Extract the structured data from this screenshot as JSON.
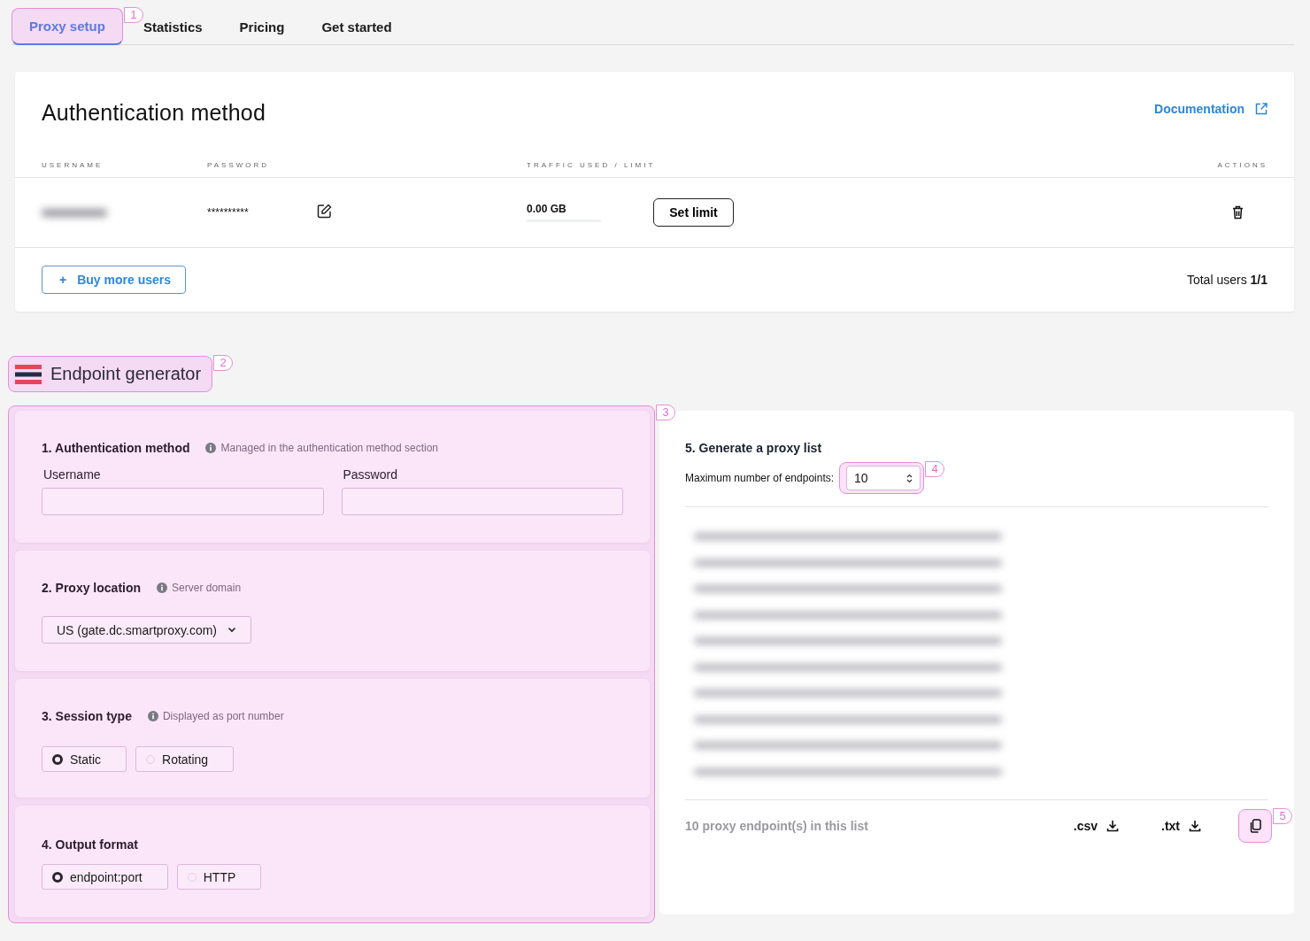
{
  "tabs": [
    {
      "label": "Proxy setup",
      "selected": true,
      "callout": "1"
    },
    {
      "label": "Statistics",
      "selected": false
    },
    {
      "label": "Pricing",
      "selected": false
    },
    {
      "label": "Get started",
      "selected": false
    }
  ],
  "auth_card": {
    "title": "Authentication method",
    "doc_link": "Documentation",
    "columns": [
      "USERNAME",
      "PASSWORD",
      "TRAFFIC USED / LIMIT",
      "ACTIONS"
    ],
    "rows": [
      {
        "username": {
          "kind": "redacted"
        },
        "password": "**********",
        "traffic": "0.00 GB",
        "level": 0,
        "limit_button": "Set limit"
      }
    ],
    "add_icon": "+",
    "add_button": "Buy more users",
    "total": "Total users **1/1**"
  },
  "generator": {
    "title": "Endpoint generator",
    "callout": "2",
    "form_callout": "3",
    "sections": [
      {
        "kind": "fields",
        "title": "1. Authentication method",
        "hint": "Managed in the authentication method section",
        "fields": [
          {
            "label": "Username"
          },
          {
            "label": "Password"
          }
        ]
      },
      {
        "kind": "select",
        "title": "2. Proxy location",
        "hint": "Server domain",
        "value": "US (gate.dc.smartproxy.com)"
      },
      {
        "kind": "radios",
        "title": "3. Session type",
        "hint": "Displayed as port number",
        "options": [
          {
            "label": "Static",
            "selected": true
          },
          {
            "label": "Rotating",
            "selected": false
          }
        ]
      },
      {
        "kind": "radios",
        "title": "4. Output format",
        "options": [
          {
            "label": "endpoint:port",
            "selected": true
          },
          {
            "label": "HTTP",
            "selected": false
          }
        ]
      }
    ],
    "list_panel": {
      "title": "5. Generate a proxy list",
      "max_label": "Maximum number of endpoints:",
      "max_value": "10",
      "max_callout": "4",
      "rows": [
        {
          "kind": "redacted"
        },
        {
          "kind": "redacted"
        },
        {
          "kind": "redacted"
        },
        {
          "kind": "redacted"
        },
        {
          "kind": "redacted"
        },
        {
          "kind": "redacted"
        },
        {
          "kind": "redacted"
        },
        {
          "kind": "redacted"
        },
        {
          "kind": "redacted"
        },
        {
          "kind": "redacted"
        }
      ],
      "count": "10 proxy endpoint(s) in this list",
      "downloads": [
        ".csv",
        ".txt"
      ],
      "copy_callout": "5"
    }
  }
}
